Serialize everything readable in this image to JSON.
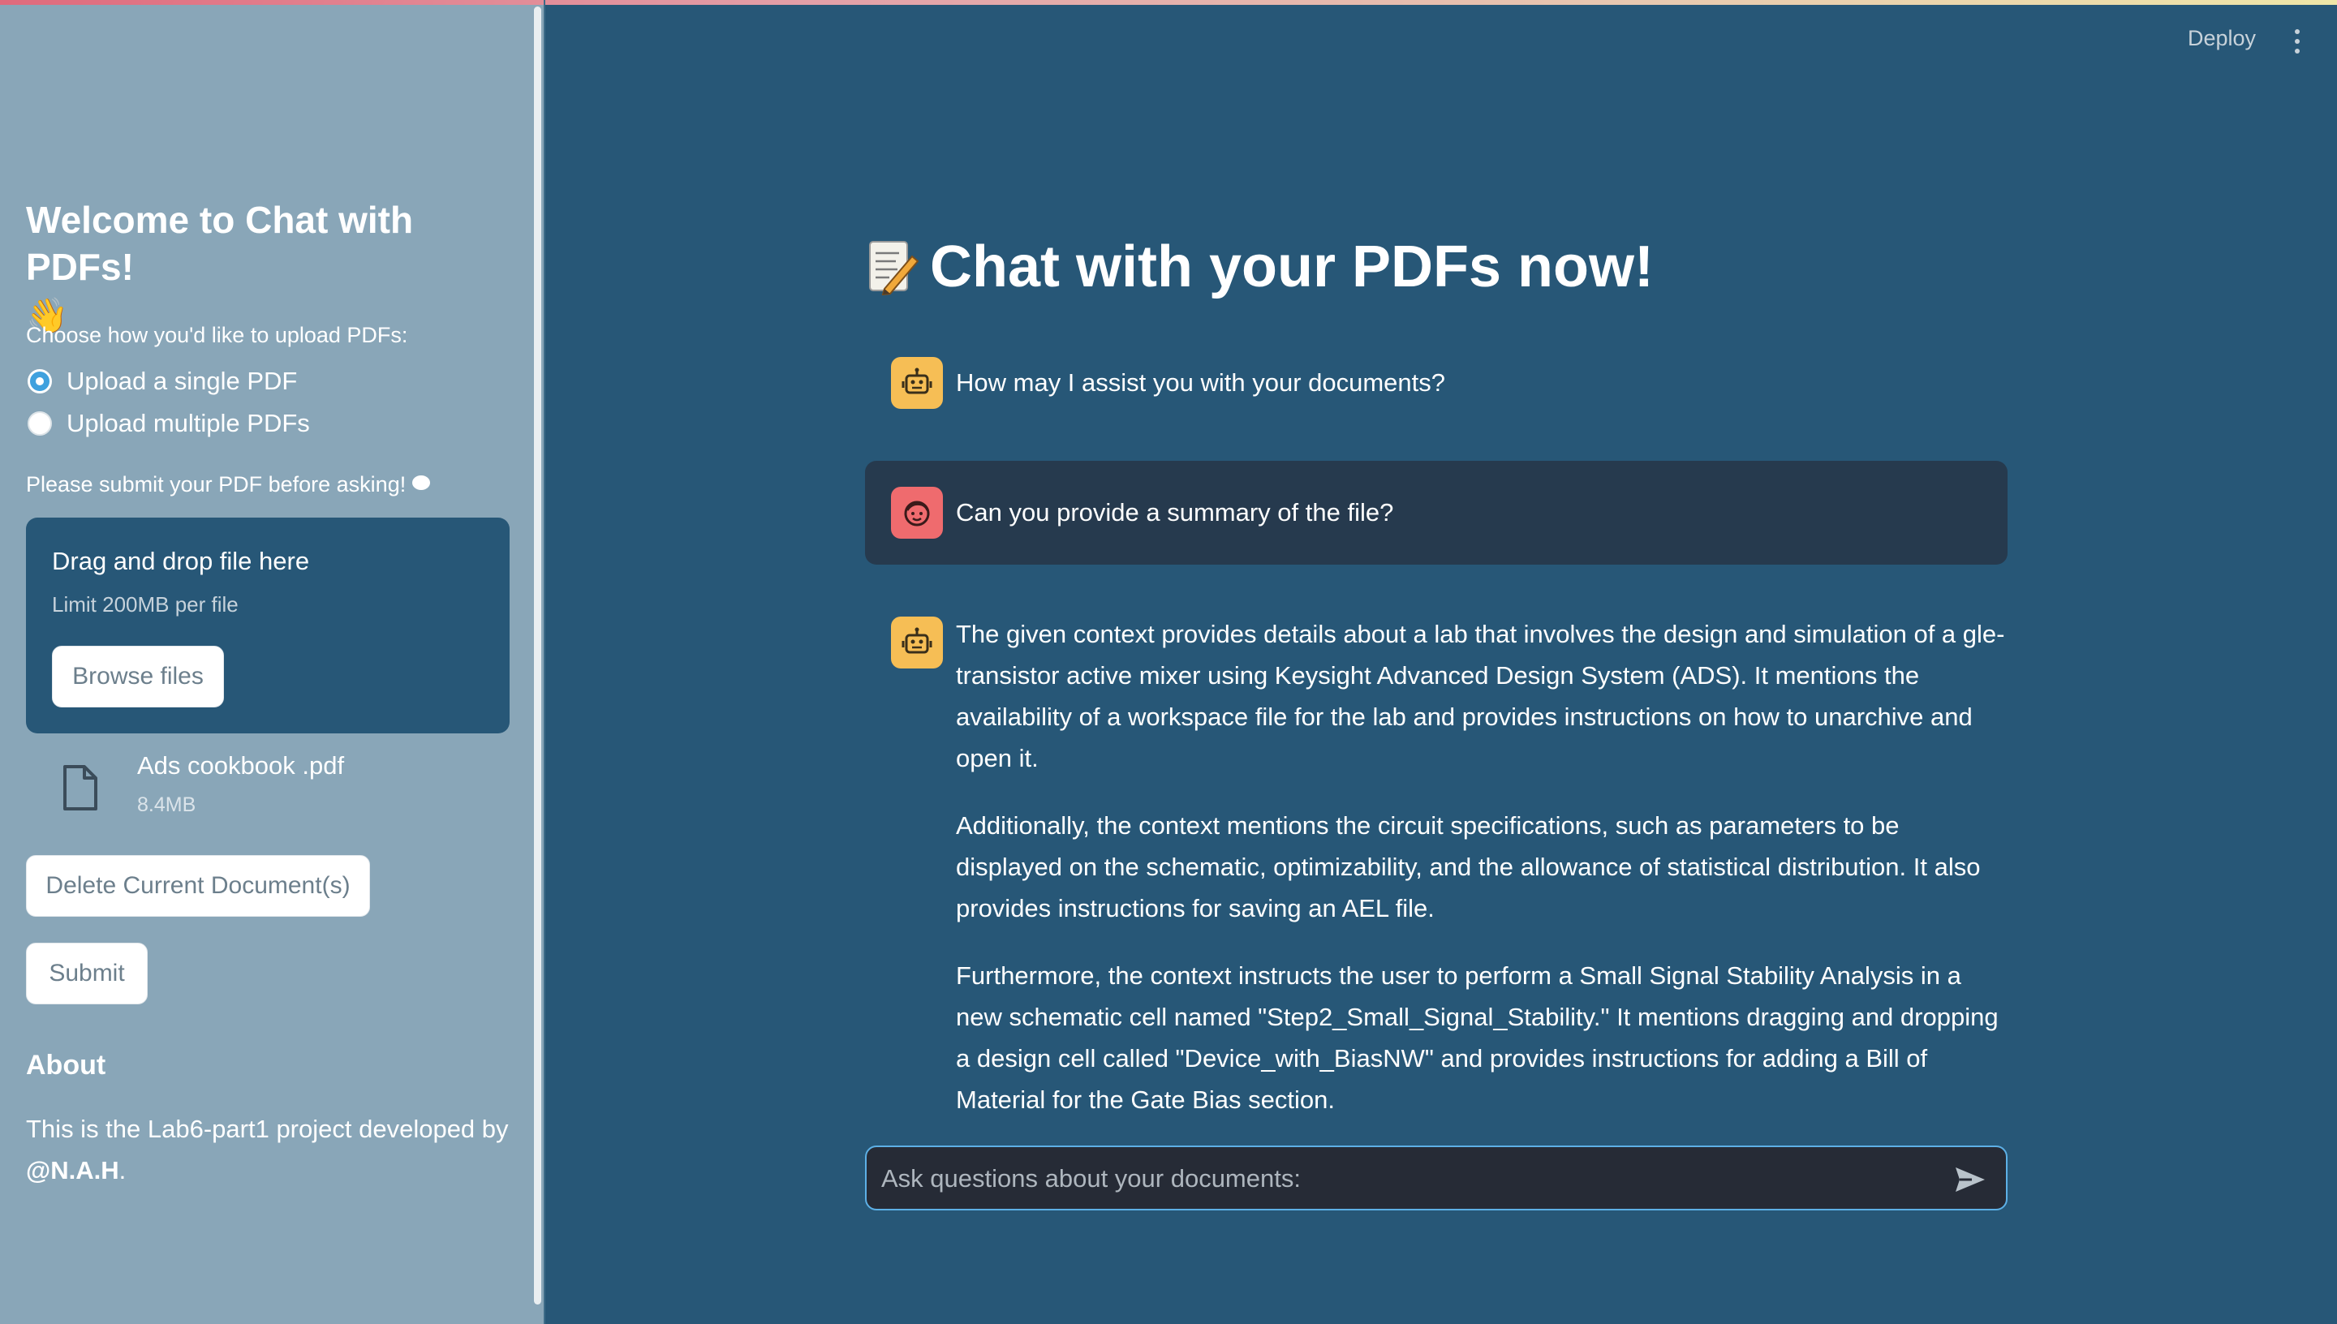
{
  "sidebar": {
    "title": "Welcome to Chat with PDFs!",
    "title_emoji": "👋",
    "upload_prompt": "Choose how you'd like to upload PDFs:",
    "radio_options": [
      "Upload a single PDF",
      "Upload multiple PDFs"
    ],
    "selected_option": "Upload a single PDF",
    "submit_prompt": "Please submit your PDF before asking!",
    "dropzone": {
      "title": "Drag and drop file here",
      "limit": "Limit 200MB per file",
      "browse_label": "Browse files"
    },
    "uploaded_file": {
      "name": "Ads cookbook .pdf",
      "size": "8.4MB"
    },
    "delete_label": "Delete Current Document(s)",
    "submit_label": "Submit",
    "about_heading": "About",
    "about_text": "This is the Lab6-part1 project developed by",
    "about_author": "@N.A.H",
    "about_suffix": "."
  },
  "header": {
    "deploy_label": "Deploy"
  },
  "main": {
    "title": "Chat with your PDFs now!",
    "messages": [
      {
        "role": "assistant",
        "paragraphs": [
          "How may I assist you with your documents?"
        ]
      },
      {
        "role": "user",
        "paragraphs": [
          "Can you provide a summary of the file?"
        ]
      },
      {
        "role": "assistant",
        "paragraphs": [
          "The given context provides details about a lab that involves the design and simulation of a gle-transistor active mixer using Keysight Advanced Design System (ADS). It mentions the availability of a workspace file for the lab and provides instructions on how to unarchive and open it.",
          "Additionally, the context mentions the circuit specifications, such as parameters to be displayed on the schematic, optimizability, and the allowance of statistical distribution. It also provides instructions for saving an AEL file.",
          "Furthermore, the context instructs the user to perform a Small Signal Stability Analysis in a new schematic cell named \"Step2_Small_Signal_Stability.\" It mentions dragging and dropping a design cell called \"Device_with_BiasNW\" and provides instructions for adding a Bill of Material for the Gate Bias section."
        ]
      }
    ],
    "input_placeholder": "Ask questions about your documents:"
  },
  "colors": {
    "sidebar_bg": "#89a6b8",
    "main_bg": "#275777",
    "bot_avatar": "#f6be55",
    "user_avatar": "#ef6b6e",
    "user_msg_bg": "#263a4e",
    "input_border": "#5db0e6"
  },
  "icons": [
    "waving-hand-icon",
    "speech-bubble-icon",
    "file-icon",
    "memo-icon",
    "robot-icon",
    "face-icon",
    "send-icon",
    "kebab-menu-icon"
  ]
}
